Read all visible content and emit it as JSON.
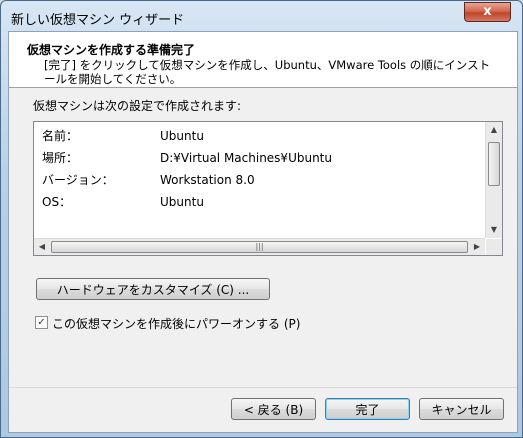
{
  "window": {
    "title": "新しい仮想マシン ウィザード",
    "close_label": "x"
  },
  "header": {
    "title": "仮想マシンを作成する準備完了",
    "description": "[完了] をクリックして仮想マシンを作成し、Ubuntu、VMware Tools の順にインストールを開始してください。"
  },
  "summary": {
    "label": "仮想マシンは次の設定で作成されます:",
    "rows": [
      {
        "key": "名前：",
        "value": "Ubuntu"
      },
      {
        "key": "場所：",
        "value": "D:¥Virtual Machines¥Ubuntu"
      },
      {
        "key": "バージョン：",
        "value": "Workstation 8.0"
      },
      {
        "key": "OS：",
        "value": "Ubuntu"
      }
    ]
  },
  "customize_button": {
    "label": "ハードウェアをカスタマイズ (C) ..."
  },
  "power_on": {
    "label": "この仮想マシンを作成後にパワーオンする (P)",
    "checked": true
  },
  "footer": {
    "back_label": "< 戻る (B)",
    "finish_label": "完了",
    "cancel_label": "キャンセル"
  }
}
